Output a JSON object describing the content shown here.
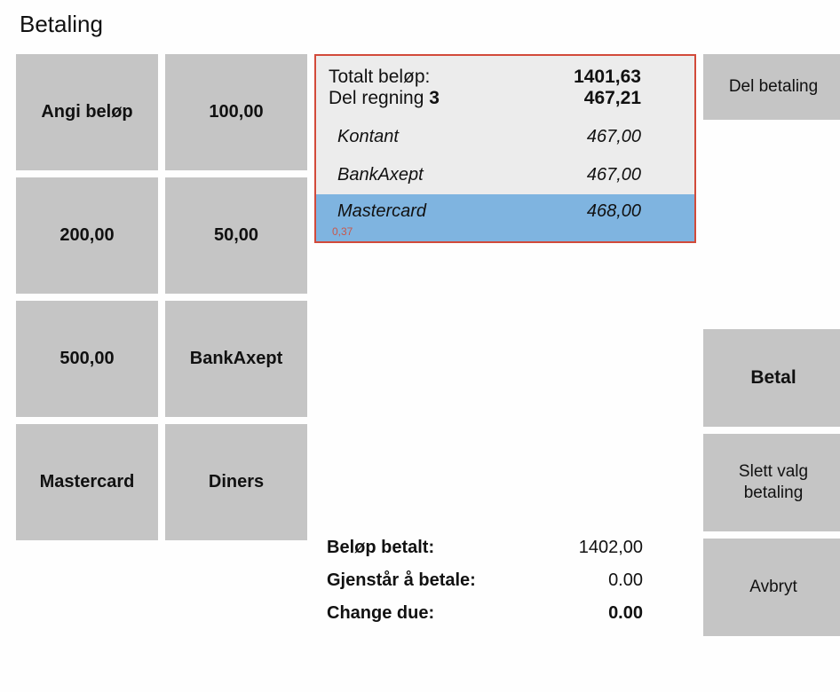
{
  "title": "Betaling",
  "keypad": [
    {
      "name": "angi-belop-button",
      "label": "Angi beløp"
    },
    {
      "name": "amount-100-button",
      "label": "100,00"
    },
    {
      "name": "amount-200-button",
      "label": "200,00"
    },
    {
      "name": "amount-50-button",
      "label": "50,00"
    },
    {
      "name": "amount-500-button",
      "label": "500,00"
    },
    {
      "name": "bankaxept-button",
      "label": "BankAxept"
    },
    {
      "name": "mastercard-button",
      "label": "Mastercard"
    },
    {
      "name": "diners-button",
      "label": "Diners"
    }
  ],
  "summary": {
    "total_label": "Totalt beløp:",
    "total_value": "1401,63",
    "split_label_prefix": "Del regning ",
    "split_count": "3",
    "split_value": "467,21",
    "lines": [
      {
        "method": "Kontant",
        "amount": "467,00",
        "selected": false
      },
      {
        "method": "BankAxept",
        "amount": "467,00",
        "selected": false
      },
      {
        "method": "Mastercard",
        "amount": "468,00",
        "selected": true,
        "sub": "0,37"
      }
    ]
  },
  "totals": {
    "paid_label": "Beløp betalt:",
    "paid_value": "1402,00",
    "remaining_label": "Gjenstår å betale:",
    "remaining_value": "0.00",
    "change_label": "Change due:",
    "change_value": "0.00"
  },
  "actions": {
    "split": "Del betaling",
    "pay": "Betal",
    "delete_selected": "Slett valg betaling",
    "cancel": "Avbryt"
  }
}
